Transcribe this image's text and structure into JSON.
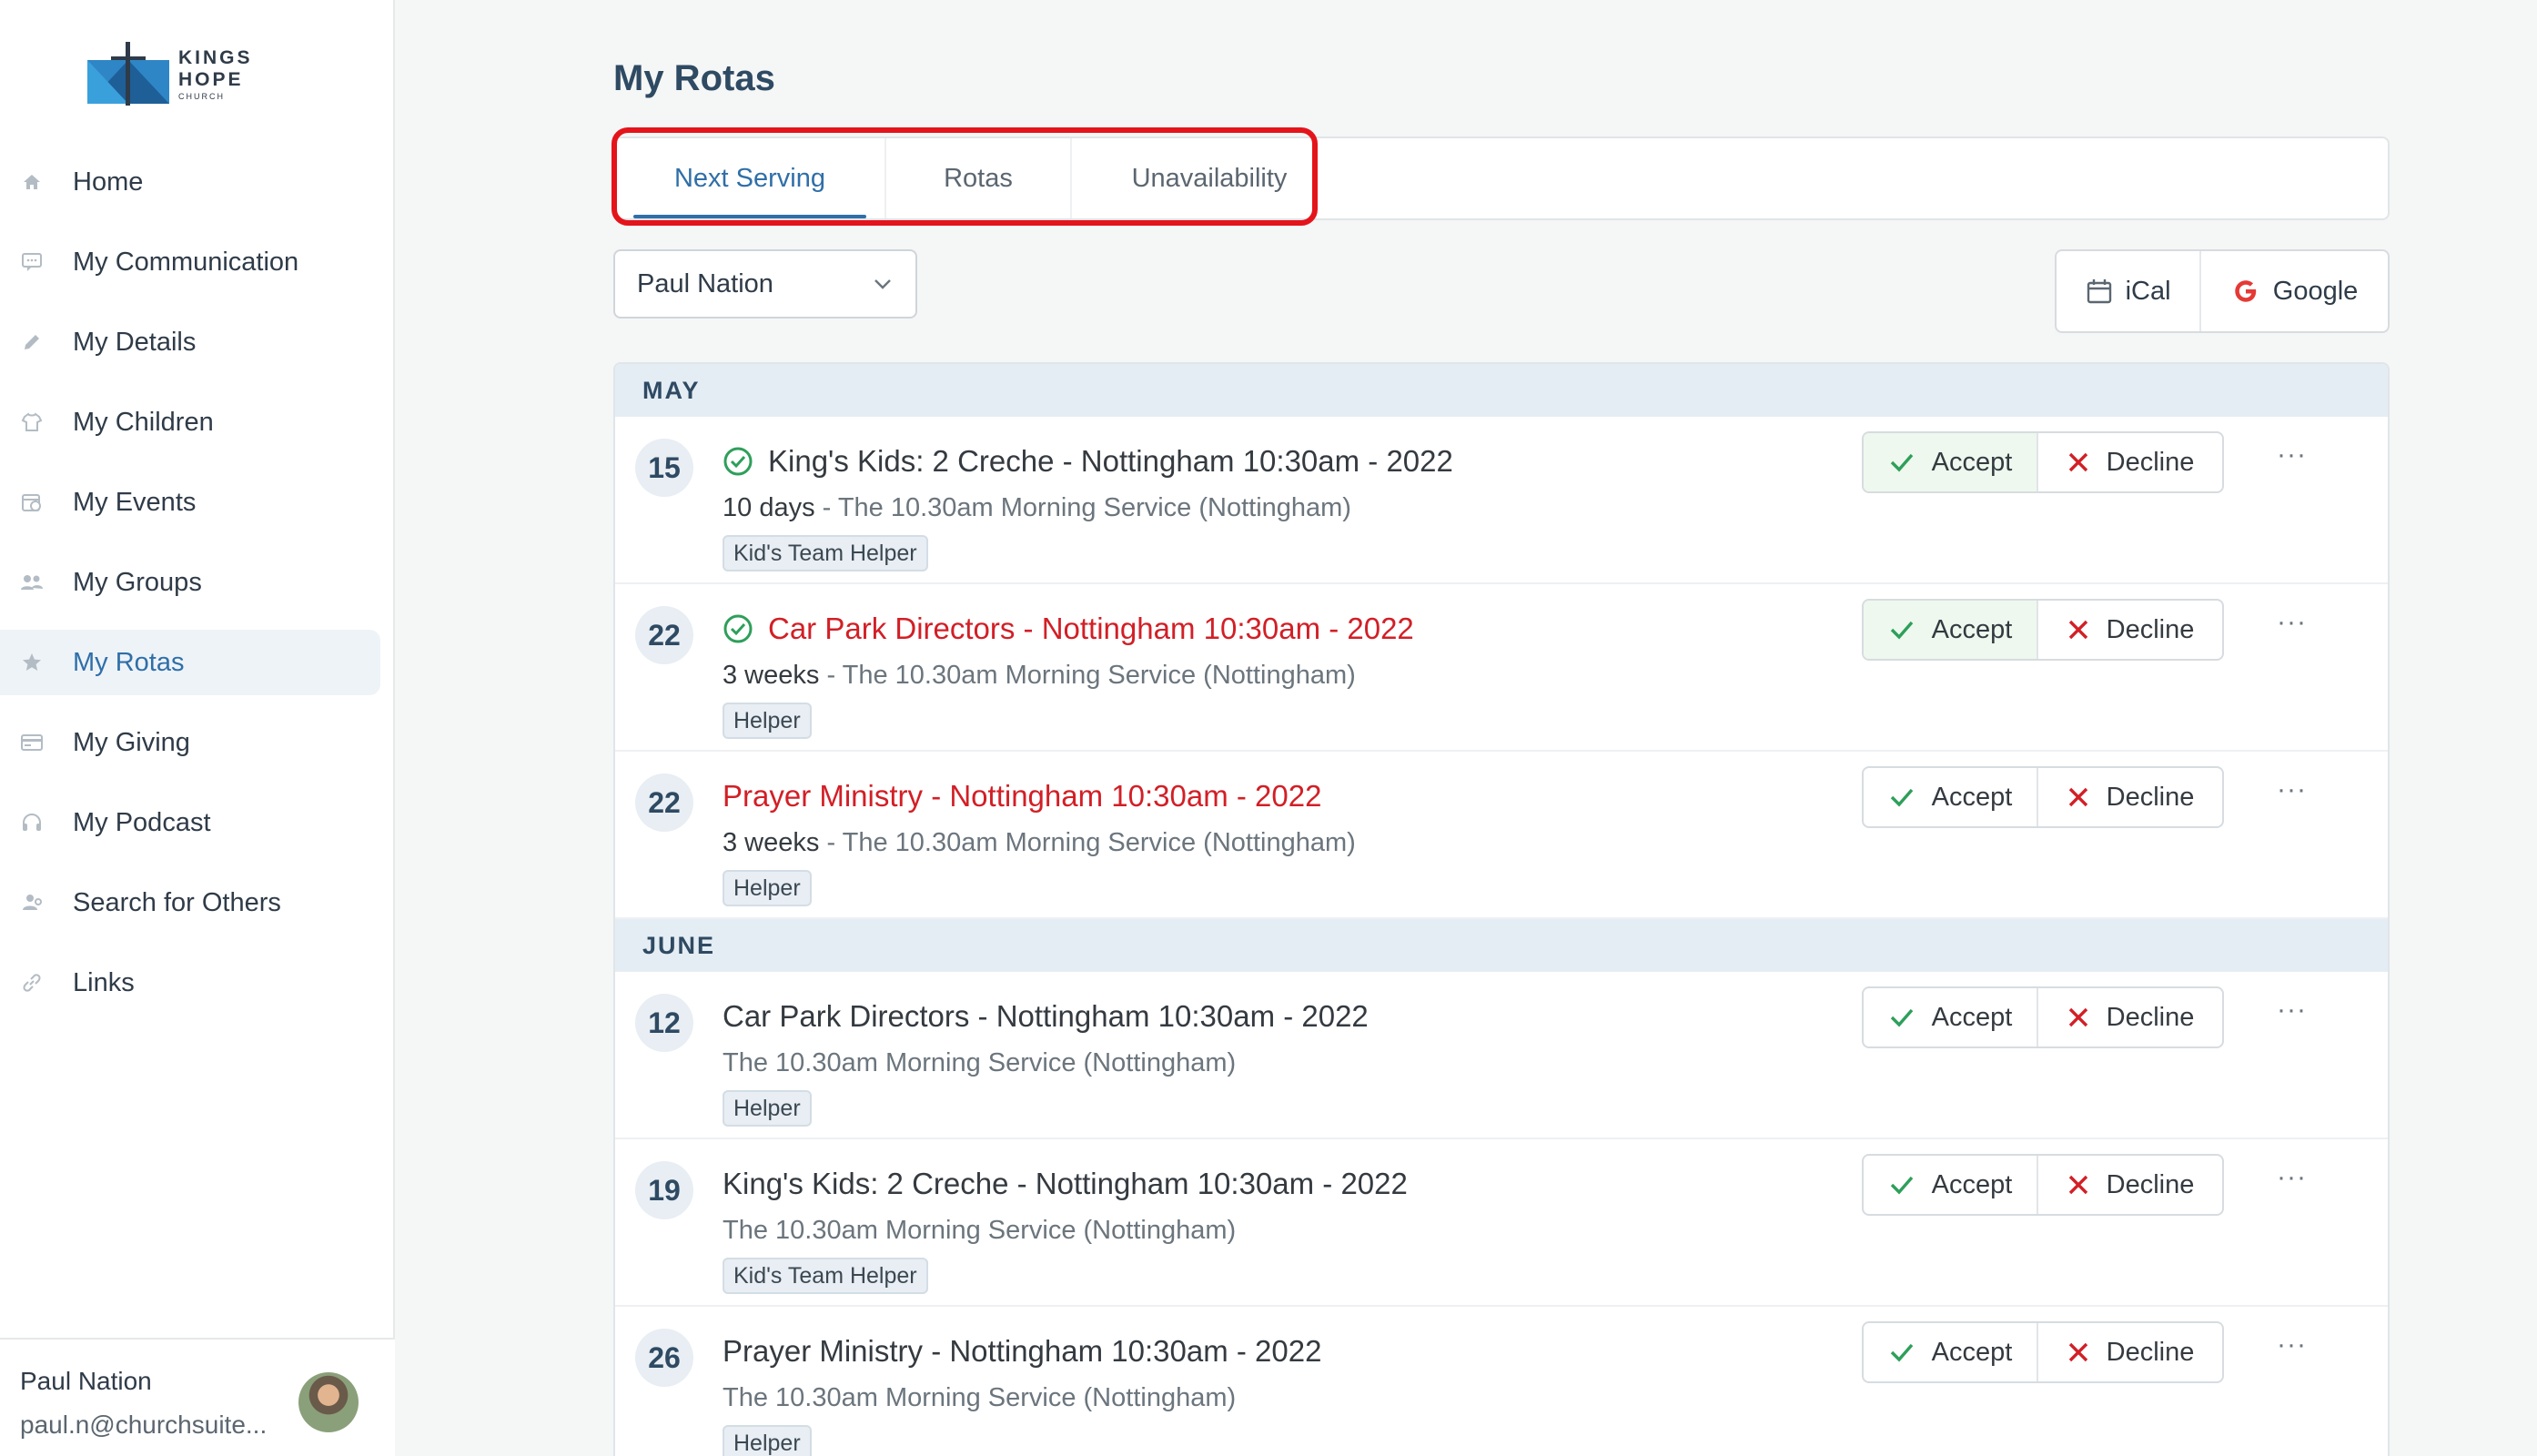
{
  "sidebar": {
    "logo": {
      "title": "KINGS HOPE",
      "subtitle": "CHURCH"
    },
    "items": [
      {
        "label": "Home",
        "icon": "home-icon"
      },
      {
        "label": "My Communication",
        "icon": "chat-icon"
      },
      {
        "label": "My Details",
        "icon": "pencil-icon"
      },
      {
        "label": "My Children",
        "icon": "shirt-icon"
      },
      {
        "label": "My Events",
        "icon": "calendar-clock-icon"
      },
      {
        "label": "My Groups",
        "icon": "people-icon"
      },
      {
        "label": "My Rotas",
        "icon": "star-icon",
        "active": true
      },
      {
        "label": "My Giving",
        "icon": "card-icon"
      },
      {
        "label": "My Podcast",
        "icon": "headphones-icon"
      },
      {
        "label": "Search for Others",
        "icon": "person-search-icon"
      },
      {
        "label": "Links",
        "icon": "link-icon"
      }
    ],
    "user": {
      "name": "Paul Nation",
      "email": "paul.n@churchsuite..."
    }
  },
  "main": {
    "title": "My Rotas",
    "tabs": [
      {
        "label": "Next Serving",
        "active": true
      },
      {
        "label": "Rotas"
      },
      {
        "label": "Unavailability"
      }
    ],
    "person_select": {
      "value": "Paul Nation"
    },
    "calendar": {
      "ical_label": "iCal",
      "google_label": "Google"
    },
    "accept_label": "Accept",
    "decline_label": "Decline",
    "more_label": "···",
    "months": [
      {
        "name": "MAY",
        "rows": [
          {
            "day": "15",
            "title": "King's Kids: 2 Creche - Nottingham 10:30am - 2022",
            "red": false,
            "accepted": true,
            "when": "10 days",
            "sep": " - ",
            "service": "The 10.30am Morning Service (Nottingham)",
            "role": "Kid's Team Helper"
          },
          {
            "day": "22",
            "title": "Car Park Directors - Nottingham 10:30am - 2022",
            "red": true,
            "accepted": true,
            "when": "3 weeks",
            "sep": " - ",
            "service": "The 10.30am Morning Service (Nottingham)",
            "role": "Helper"
          },
          {
            "day": "22",
            "title": "Prayer Ministry - Nottingham 10:30am - 2022",
            "red": true,
            "accepted": false,
            "when": "3 weeks",
            "sep": " - ",
            "service": "The 10.30am Morning Service (Nottingham)",
            "role": "Helper"
          }
        ]
      },
      {
        "name": "JUNE",
        "rows": [
          {
            "day": "12",
            "title": "Car Park Directors - Nottingham 10:30am - 2022",
            "red": false,
            "accepted": false,
            "when": "",
            "sep": "",
            "service": "The 10.30am Morning Service (Nottingham)",
            "role": "Helper"
          },
          {
            "day": "19",
            "title": "King's Kids: 2 Creche - Nottingham 10:30am - 2022",
            "red": false,
            "accepted": false,
            "when": "",
            "sep": "",
            "service": "The 10.30am Morning Service (Nottingham)",
            "role": "Kid's Team Helper"
          },
          {
            "day": "26",
            "title": "Prayer Ministry - Nottingham 10:30am - 2022",
            "red": false,
            "accepted": false,
            "when": "",
            "sep": "",
            "service": "The 10.30am Morning Service (Nottingham)",
            "role": "Helper"
          }
        ]
      }
    ]
  },
  "colors": {
    "accent": "#2f6fa8",
    "highlight": "#e4141b",
    "accepted": "#2e9f5a",
    "decline": "#d21f26"
  }
}
